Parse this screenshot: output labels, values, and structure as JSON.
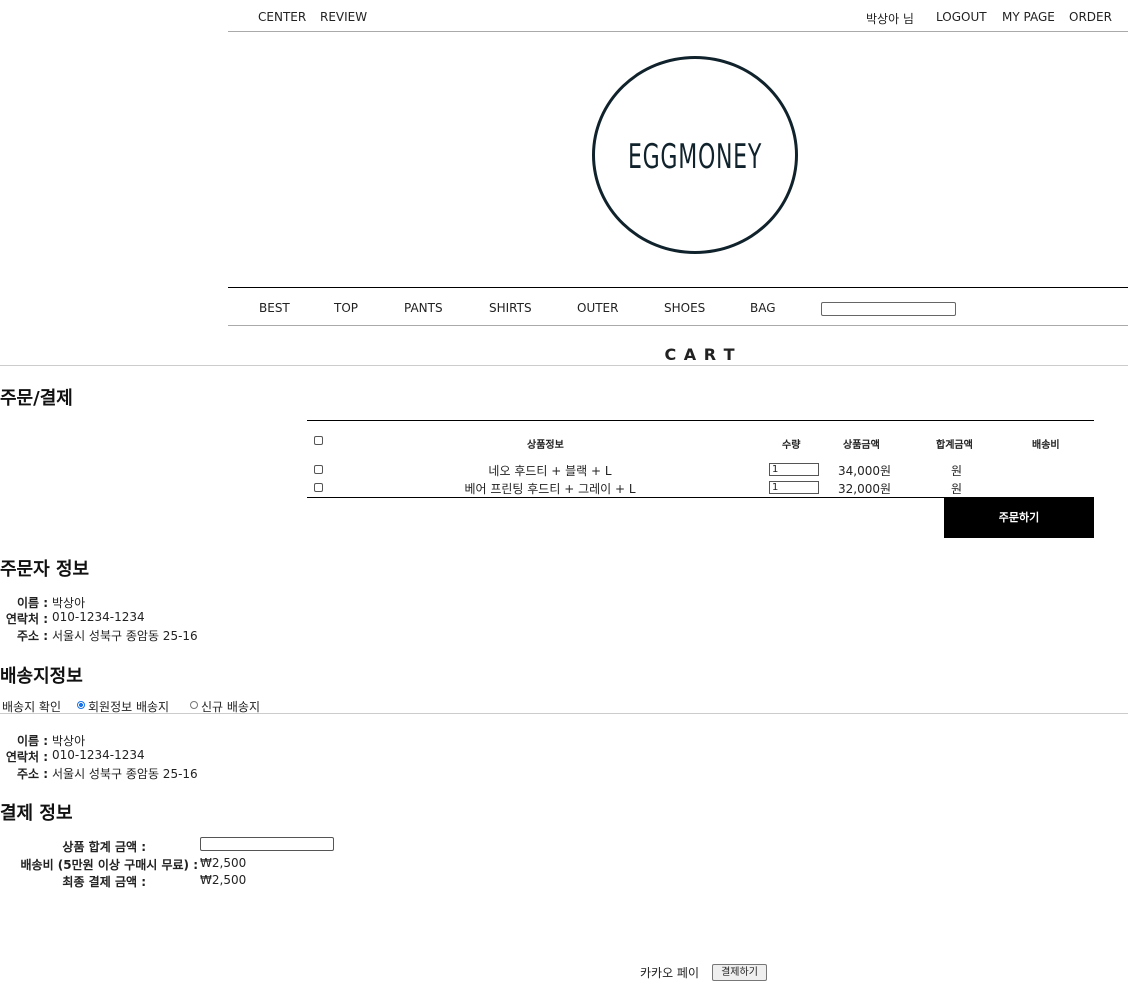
{
  "topnav": {
    "left": [
      "CENTER",
      "REVIEW"
    ],
    "user": "박상아 님",
    "right": [
      "LOGOUT",
      "MY PAGE",
      "ORDER"
    ]
  },
  "logo": {
    "text": "EGGMONEY"
  },
  "mainnav": {
    "items": [
      "BEST",
      "TOP",
      "PANTS",
      "SHIRTS",
      "OUTER",
      "SHOES",
      "BAG"
    ],
    "search_value": ""
  },
  "page_heading": "C A R T",
  "order_title": "주문/결제",
  "cart": {
    "headers": {
      "product": "상품정보",
      "qty": "수량",
      "price": "상품금액",
      "total": "합계금액",
      "shipping": "배송비"
    },
    "rows": [
      {
        "product": "네오 후드티 + 블랙 + L",
        "qty": "1",
        "price": "34,000원",
        "total": "원"
      },
      {
        "product": "베어 프린팅 후드티 + 그레이 + L",
        "qty": "1",
        "price": "32,000원",
        "total": "원"
      }
    ],
    "order_button": "주문하기"
  },
  "orderer": {
    "title": "주문자 정보",
    "name_label": "이름 :",
    "name": "박상아",
    "phone_label": "연락처 :",
    "phone": "010-1234-1234",
    "address_label": "주소 :",
    "address": "서울시 성북구 종암동 25-16"
  },
  "delivery": {
    "title": "배송지정보",
    "confirm_label": "배송지 확인",
    "option_member": "회원정보 배송지",
    "option_new": "신규 배송지",
    "name_label": "이름 :",
    "name": "박상아",
    "phone_label": "연락처 :",
    "phone": "010-1234-1234",
    "address_label": "주소 :",
    "address": "서울시 성북구 종암동 25-16"
  },
  "payment": {
    "title": "결제 정보",
    "subtotal_label": "상품 합계 금액 :",
    "subtotal_value": "",
    "shipping_label": "배송비 (5만원 이상 구매시 무료) :",
    "shipping_value": "₩2,500",
    "final_label": "최종 결제 금액 :",
    "final_value": "₩2,500",
    "kakao_label": "카카오 페이",
    "pay_button": "결제하기"
  }
}
